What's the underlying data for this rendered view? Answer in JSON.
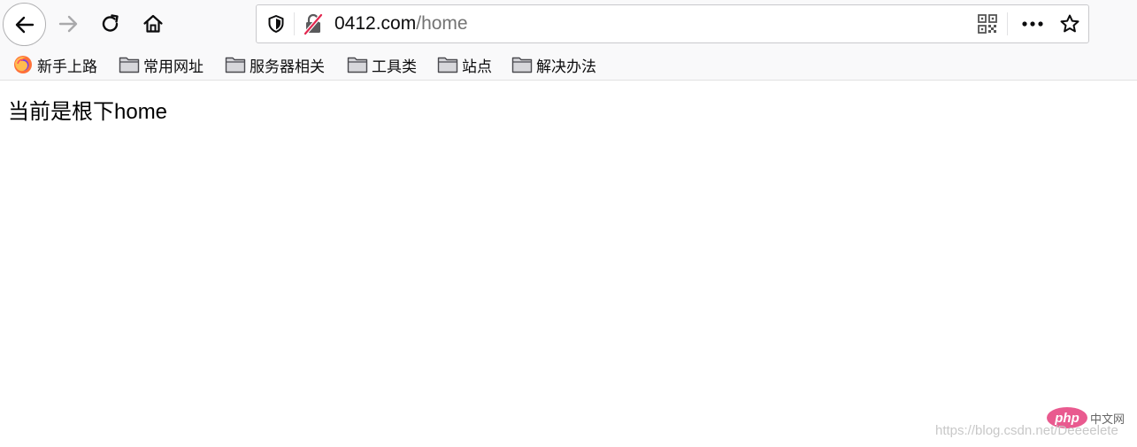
{
  "address_bar": {
    "domain": "0412.com",
    "path": "/home"
  },
  "bookmarks": [
    {
      "label": "新手上路",
      "icon": "firefox-icon"
    },
    {
      "label": "常用网址",
      "icon": "folder-icon"
    },
    {
      "label": "服务器相关",
      "icon": "folder-icon"
    },
    {
      "label": "工具类",
      "icon": "folder-icon"
    },
    {
      "label": "站点",
      "icon": "folder-icon"
    },
    {
      "label": "解决办法",
      "icon": "folder-icon"
    }
  ],
  "page": {
    "text": "当前是根下home"
  },
  "watermark": {
    "url": "https://blog.csdn.net/Deeeelete",
    "badge": "php",
    "site": "中文网"
  },
  "colors": {
    "toolbar_bg": "#f9f9fa",
    "insecure_slash": "#e22850",
    "badge_pink": "#e95a8f"
  }
}
